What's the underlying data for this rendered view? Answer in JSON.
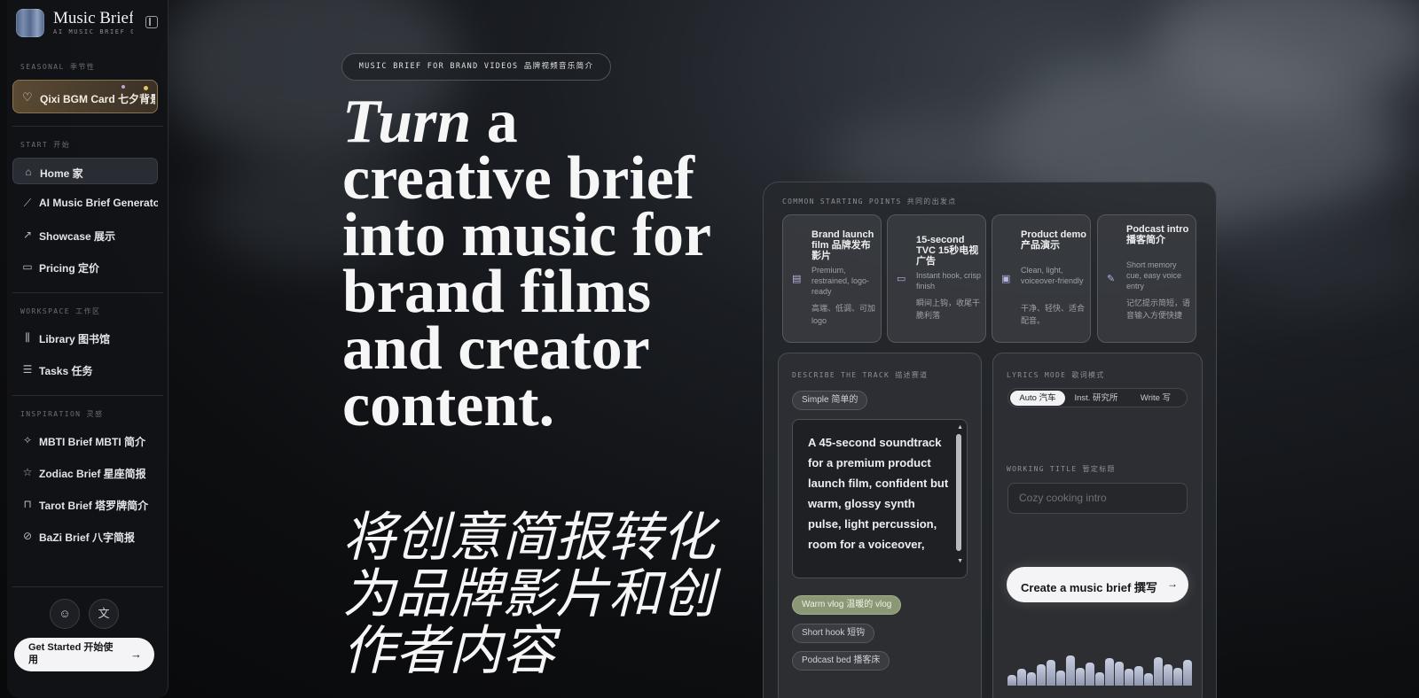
{
  "sidebar": {
    "brand_title": "Music Brief",
    "brand_sub": "AI MUSIC BRIEF GENERATOR",
    "seasonal_label": "SEASONAL  季节性",
    "qixi_label": "Qixi BGM Card  七夕背景",
    "start_label": "START  开始",
    "start_items": [
      {
        "label": "Home  家",
        "icon": "home-icon"
      },
      {
        "label": "AI Music Brief Generator  AI",
        "icon": "wand-icon"
      },
      {
        "label": "Showcase  展示",
        "icon": "trend-icon"
      },
      {
        "label": "Pricing  定价",
        "icon": "card-icon"
      }
    ],
    "workspace_label": "WORKSPACE  工作区",
    "workspace_items": [
      {
        "label": "Library  图书馆",
        "icon": "library-icon"
      },
      {
        "label": "Tasks  任务",
        "icon": "tasks-icon"
      }
    ],
    "inspiration_label": "INSPIRATION  灵感",
    "inspiration_items": [
      {
        "label": "MBTI Brief  MBTI 简介",
        "icon": "sparkle-icon"
      },
      {
        "label": "Zodiac Brief  星座简报",
        "icon": "star-icon"
      },
      {
        "label": "Tarot Brief  塔罗牌简介",
        "icon": "book-icon"
      },
      {
        "label": "BaZi Brief  八字简报",
        "icon": "compass-icon"
      }
    ],
    "get_started": "Get Started  开始使用"
  },
  "hero": {
    "pill": "MUSIC BRIEF FOR BRAND VIDEOS  品牌视频音乐简介",
    "headline_italic": "Turn",
    "headline_rest": " a creative brief into music for brand films and creator content.",
    "headline_cn": "将创意简报转化为品牌影片和创作者内容"
  },
  "panel": {
    "starting_label": "COMMON STARTING POINTS  共同的出发点",
    "cards": [
      {
        "title": "Brand launch film  品牌发布影片",
        "desc": "Premium, restrained, logo-ready",
        "cn": "高端、低调、可加 logo",
        "icon": "clapper-icon"
      },
      {
        "title": "15-second TVC  15秒电视广告",
        "desc": "Instant hook, crisp finish",
        "cn": "瞬间上钩，收尾干脆利落",
        "icon": "video-icon"
      },
      {
        "title": "Product demo  产品演示",
        "desc": "Clean, light, voiceover-friendly",
        "cn": "干净、轻快、适合配音。",
        "icon": "monitor-icon"
      },
      {
        "title": "Podcast intro  播客简介",
        "desc": "Short memory cue, easy voice entry",
        "cn": "记忆提示简短，语音输入方便快捷",
        "icon": "mic-icon"
      }
    ],
    "describe_label": "DESCRIBE THE TRACK  描述赛道",
    "simple_chip": "Simple  简单的",
    "track_text": "A 45-second soundtrack for a premium product launch film, confident but warm, glossy synth pulse, light percussion, room for a voiceover,",
    "chips": [
      "Warm vlog  温暖的 vlog",
      "Short hook  短钩",
      "Podcast bed  播客床"
    ],
    "lyrics_label": "LYRICS MODE  歌词模式",
    "lyrics_options": [
      "Auto  汽车",
      "Inst.  研究所",
      "Write  写"
    ],
    "working_title_label": "WORKING TITLE  暂定标题",
    "working_title_placeholder": "Cozy cooking intro",
    "create_button": "Create a music brief  撰写",
    "waveform_levels": [
      0.35,
      0.55,
      0.45,
      0.7,
      0.85,
      0.5,
      1.0,
      0.6,
      0.75,
      0.45,
      0.9,
      0.8,
      0.55,
      0.65,
      0.4,
      0.95,
      0.7,
      0.6,
      0.85
    ]
  },
  "colors": {
    "accent_green": "#8b9875",
    "qixi_gold": "#8a7350",
    "icon_purple": "#b9b4e0"
  }
}
